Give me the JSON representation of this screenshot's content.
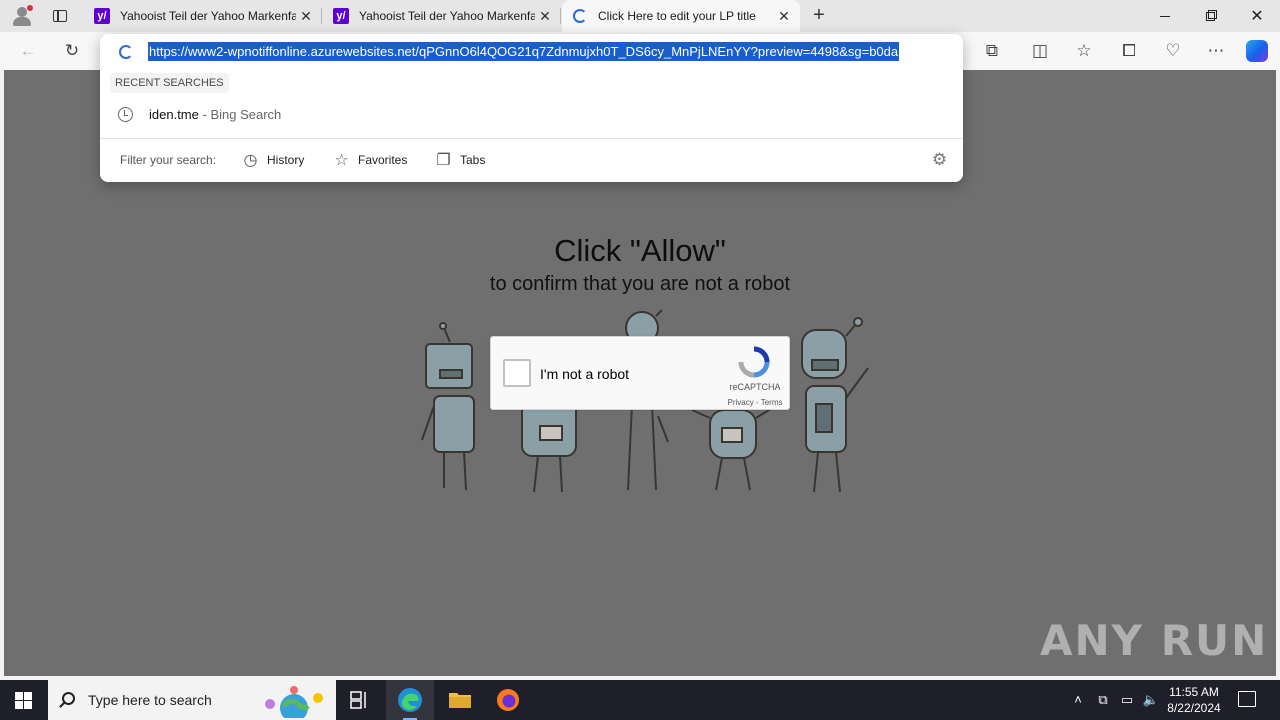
{
  "browser": {
    "tabs": [
      {
        "title": "Yahooist Teil der Yahoo Markenfa",
        "favicon": "yahoo-icon"
      },
      {
        "title": "Yahooist Teil der Yahoo Markenfa",
        "favicon": "yahoo-icon"
      },
      {
        "title": "Click Here to edit your LP title",
        "favicon": "loading-icon",
        "active": true
      }
    ],
    "address_url": "https://www2-wpnotiffonline.azurewebsites.net/qPGnnO6l4QOG21q7Zdnmujxh0T_DS6cy_MnPjLNEnYY?preview=4498&sg=b0da",
    "dropdown": {
      "section_label": "RECENT SEARCHES",
      "recent_query": "iden.tme",
      "recent_engine": "- Bing Search",
      "filter_label": "Filter your search:",
      "filters": [
        "History",
        "Favorites",
        "Tabs"
      ]
    },
    "accent_color": "#1a5fc9"
  },
  "page": {
    "headline": "Click \"Allow\"",
    "subline": "to confirm that you are not a robot",
    "captcha": {
      "label": "I'm not a robot",
      "brand": "reCAPTCHA",
      "links": "Privacy - Terms"
    },
    "watermark": "ANY RUN"
  },
  "taskbar": {
    "search_placeholder": "Type here to search",
    "time": "11:55 AM",
    "date": "8/22/2024"
  }
}
